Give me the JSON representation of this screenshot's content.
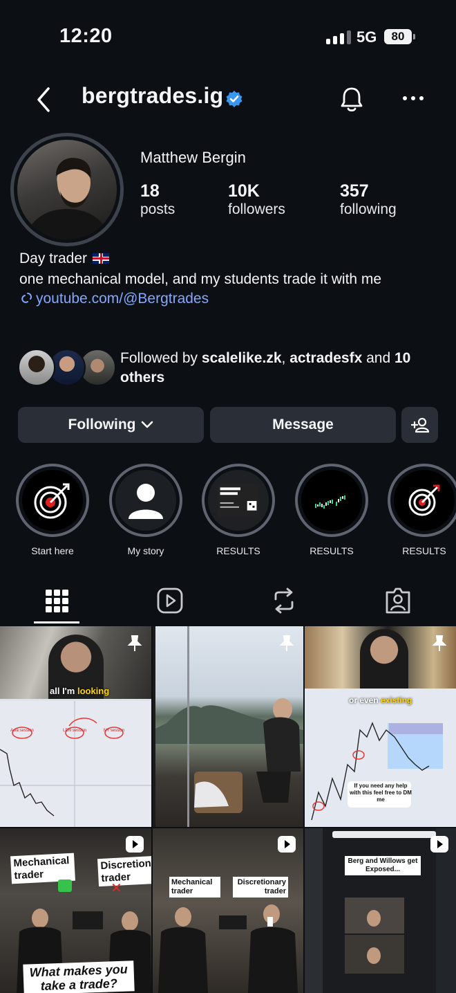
{
  "status_bar": {
    "time": "12:20",
    "network": "5G",
    "battery": "80"
  },
  "header": {
    "username": "bergtrades.ig"
  },
  "profile": {
    "full_name": "Matthew Bergin",
    "stats": [
      {
        "value": "18",
        "label": "posts"
      },
      {
        "value": "10K",
        "label": "followers"
      },
      {
        "value": "357",
        "label": "following"
      }
    ],
    "bio_line1": "Day trader",
    "bio_line2": "one mechanical model, and my students trade it with me",
    "link": "youtube.com/@Bergtrades"
  },
  "followed_by": {
    "prefix": "Followed by",
    "user1": "scalelike.zk",
    "sep": ",",
    "user2": "actradesfx",
    "and": "and",
    "others": "10 others"
  },
  "actions": {
    "following": "Following",
    "message": "Message"
  },
  "highlights": [
    {
      "label": "Start here",
      "icon": "dartboard-icon"
    },
    {
      "label": "My story",
      "icon": "person-icon"
    },
    {
      "label": "RESULTS",
      "icon": "certificate-icon"
    },
    {
      "label": "RESULTS",
      "icon": "chart-icon"
    },
    {
      "label": "RESULTS",
      "icon": "dartboard-icon"
    }
  ],
  "tabs": [
    "grid-icon",
    "reels-icon",
    "reposts-icon",
    "tagged-icon"
  ],
  "grid": {
    "post1": {
      "caption_pre": "all I'm ",
      "caption_hl": "looking",
      "labels": [
        "Asia session",
        "LDN session",
        "NY session"
      ]
    },
    "post3": {
      "caption_pre": "or even ",
      "caption_hl": "existing",
      "note": "If you need any help with this feel free to DM me"
    },
    "post4": {
      "left": "Mechanical trader",
      "right": "Discretionary trader",
      "bottom": "What makes you take a trade?"
    },
    "post5": {
      "left": "Mechanical trader",
      "right": "Discretionary trader"
    },
    "post6": {
      "title": "Berg and Willows get Exposed..."
    }
  },
  "colors": {
    "background": "#0c0f14",
    "button": "#2a2e36",
    "link": "#84a8ff",
    "verified": "#3897f0"
  }
}
